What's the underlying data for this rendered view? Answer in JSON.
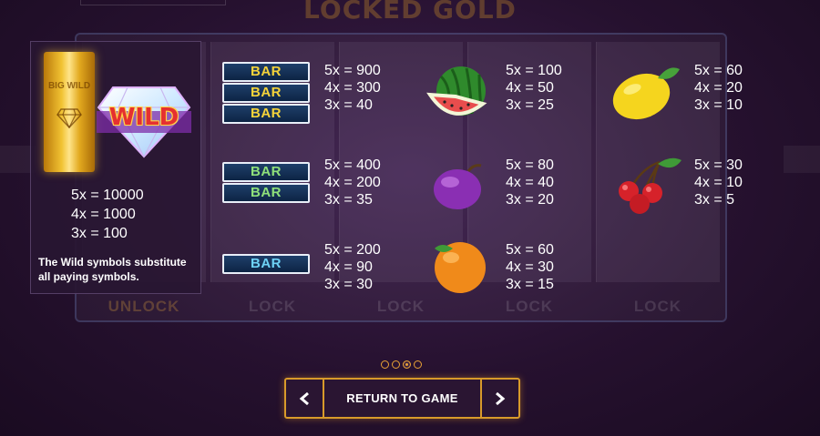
{
  "background": {
    "title": "LOCKED GOLD",
    "lock_labels": [
      "UNLOCK",
      "LOCK",
      "LOCK",
      "LOCK",
      "LOCK"
    ]
  },
  "wild": {
    "goldbar_label": "BIG WILD",
    "emblem_label": "WILD",
    "pays": [
      "5x = 10000",
      "4x = 1000",
      "3x = 100"
    ],
    "description": "The Wild symbols substitute all paying symbols."
  },
  "symbols": {
    "bar3": {
      "labels": [
        "BAR",
        "BAR",
        "BAR"
      ],
      "pays": [
        "5x = 900",
        "4x = 300",
        "3x = 40"
      ]
    },
    "bar2": {
      "labels": [
        "BAR",
        "BAR"
      ],
      "pays": [
        "5x = 400",
        "4x = 200",
        "3x = 35"
      ]
    },
    "bar1": {
      "labels": [
        "BAR"
      ],
      "pays": [
        "5x = 200",
        "4x = 90",
        "3x = 30"
      ]
    },
    "watermelon": {
      "icon": "watermelon-icon",
      "pays": [
        "5x = 100",
        "4x = 50",
        "3x = 25"
      ]
    },
    "plum": {
      "icon": "plum-icon",
      "pays": [
        "5x = 80",
        "4x = 40",
        "3x = 20"
      ]
    },
    "orange": {
      "icon": "orange-icon",
      "pays": [
        "5x = 60",
        "4x = 30",
        "3x = 15"
      ]
    },
    "lemon": {
      "icon": "lemon-icon",
      "pays": [
        "5x = 60",
        "4x = 20",
        "3x = 10"
      ]
    },
    "cherry": {
      "icon": "cherry-icon",
      "pays": [
        "5x = 30",
        "4x = 10",
        "3x = 5"
      ]
    }
  },
  "pagination": {
    "total": 4,
    "active_index": 2
  },
  "nav": {
    "prev_icon": "chevron-left-icon",
    "next_icon": "chevron-right-icon",
    "return_label": "RETURN TO GAME"
  },
  "colors": {
    "accent": "#d89a2a",
    "panel": "#281632",
    "bar_fill": "#0d2444"
  }
}
